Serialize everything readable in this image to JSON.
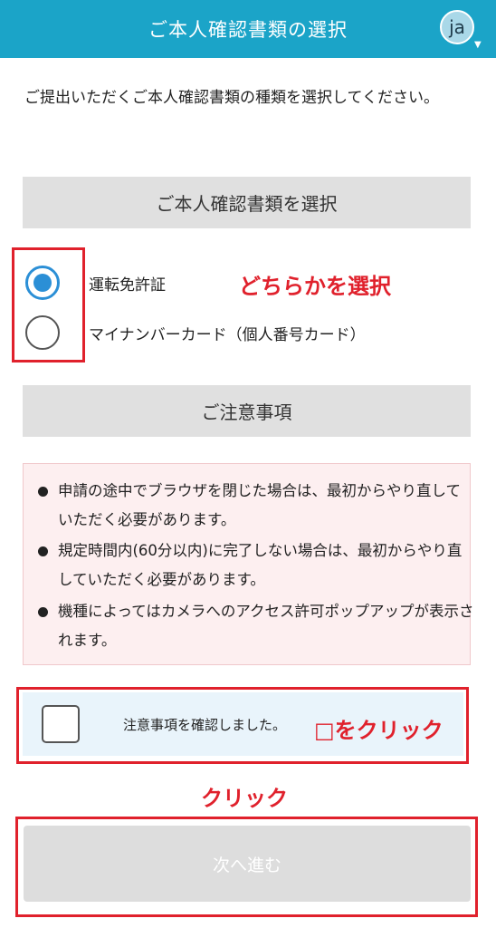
{
  "header": {
    "title": "ご本人確認書類の選択",
    "avatar_text": "ja",
    "avatar_caret": "▼"
  },
  "intro": "ご提出いただくご本人確認書類の種類を選択してください。",
  "document_section": {
    "title": "ご本人確認書類を選択",
    "options": [
      {
        "label": "運転免許証",
        "selected": true
      },
      {
        "label": "マイナンバーカード（個人番号カード）",
        "selected": false
      }
    ]
  },
  "notes_section": {
    "title": "ご注意事項",
    "items": [
      "申請の途中でブラウザを閉じた場合は、最初からやり直していただく必要があります。",
      "規定時間内(60分以内)に完了しない場合は、最初からやり直していただく必要があります。",
      "機種によってはカメラへのアクセス許可ポップアップが表示されます。"
    ]
  },
  "confirm": {
    "label": "注意事項を確認しました。",
    "checked": false
  },
  "next_button": {
    "label": "次へ進む",
    "enabled": false
  },
  "annotations": {
    "choose_one": "どちらかを選択",
    "click_checkbox": "□をクリック",
    "click": "クリック"
  },
  "colors": {
    "header_bg": "#1ba4c8",
    "radio_selected": "#2b8fd6",
    "annotation_red": "#e0212c",
    "notice_bg": "#fdeff0",
    "confirm_bg": "#e9f4fb",
    "button_disabled": "#dddddd"
  }
}
